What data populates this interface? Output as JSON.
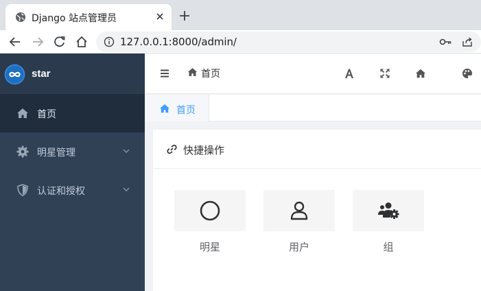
{
  "browser": {
    "tab_title": "Django 站点管理员",
    "url": "127.0.0.1:8000/admin/",
    "icons": [
      "globe-icon",
      "close-icon",
      "plus-icon",
      "back-icon",
      "forward-icon",
      "reload-icon",
      "home-icon",
      "info-icon",
      "key-icon",
      "share-icon"
    ]
  },
  "sidebar": {
    "brand": "star",
    "items": [
      {
        "label": "首页",
        "icon": "home-icon",
        "active": true
      },
      {
        "label": "明星管理",
        "icon": "gear-icon",
        "expandable": true
      },
      {
        "label": "认证和授权",
        "icon": "shield-icon",
        "expandable": true
      }
    ],
    "colors": {
      "bg": "#304156",
      "active_bg": "#1f2d3d",
      "text": "#bfcbd9"
    }
  },
  "header": {
    "breadcrumb": "首页",
    "toolbar_icons": [
      "font-size-icon",
      "fullscreen-icon",
      "home-icon",
      "palette-icon"
    ]
  },
  "tabs": [
    {
      "label": "首页",
      "icon": "home-icon",
      "active": true
    }
  ],
  "card": {
    "title": "快捷操作",
    "actions": [
      {
        "label": "明星",
        "icon": "circle-icon"
      },
      {
        "label": "用户",
        "icon": "user-icon"
      },
      {
        "label": "组",
        "icon": "users-gear-icon"
      }
    ]
  },
  "colors": {
    "accent": "#409eff"
  }
}
